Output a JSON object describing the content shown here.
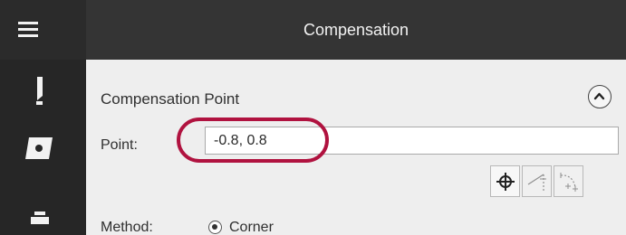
{
  "window": {
    "title": "Compensation"
  },
  "sidebar": {
    "items": [
      {
        "icon": "tool-icon"
      },
      {
        "icon": "insert-icon"
      },
      {
        "icon": "holder-icon"
      }
    ]
  },
  "section": {
    "title": "Compensation Point",
    "collapse_icon": "chevron-up-icon"
  },
  "point": {
    "label": "Point:",
    "value": "-0.8, 0.8"
  },
  "point_tools": [
    {
      "icon": "crosshair-icon",
      "enabled": true
    },
    {
      "icon": "line-point-icon",
      "enabled": false
    },
    {
      "icon": "arc-point-icon",
      "enabled": false
    }
  ],
  "method": {
    "label": "Method:",
    "selected_option": "Corner"
  },
  "colors": {
    "titlebar": "#343434",
    "rail": "#262626",
    "panel": "#eeeeee",
    "highlight": "#b0123f"
  }
}
